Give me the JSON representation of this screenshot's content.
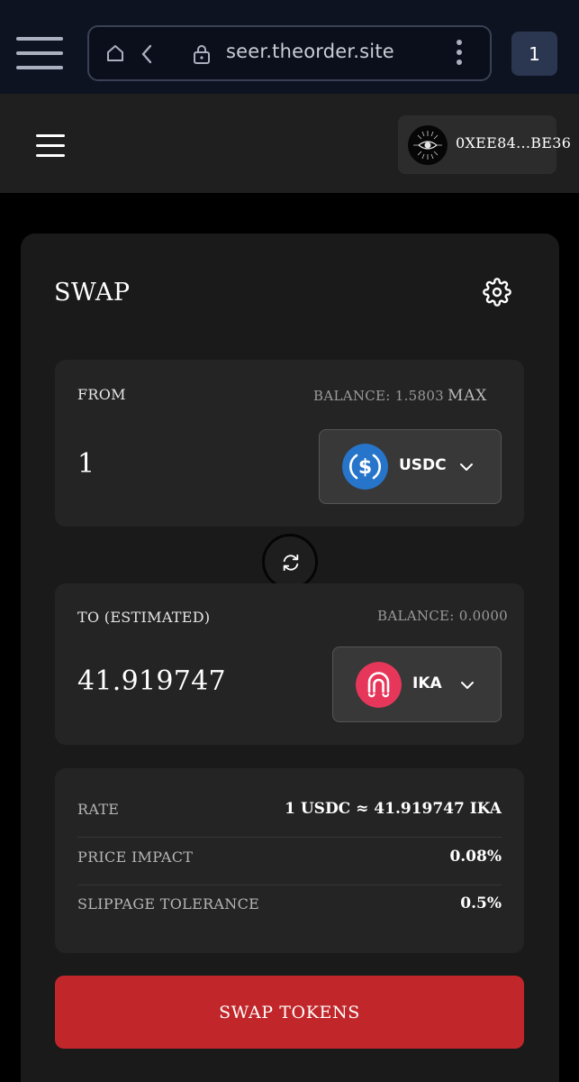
{
  "browser": {
    "url": "seer.theorder.site",
    "tab_count": "1"
  },
  "header": {
    "wallet_address": "0XEE84...BE36"
  },
  "swap": {
    "title": "SWAP",
    "from": {
      "label": "FROM",
      "balance": "BALANCE: 1.5803",
      "max_label": "MAX",
      "amount": "1",
      "token": "USDC",
      "token_icon": "usdc-icon",
      "token_color": "#2775ca"
    },
    "to": {
      "label": "TO (ESTIMATED)",
      "balance": "BALANCE: 0.0000",
      "amount": "41.919747",
      "token": "IKA",
      "token_icon": "ika-icon",
      "token_color": "#e6375a"
    },
    "details": [
      {
        "label": "RATE",
        "value": "1 USDC ≈ 41.919747 IKA"
      },
      {
        "label": "PRICE IMPACT",
        "value": "0.08%"
      },
      {
        "label": "SLIPPAGE TOLERANCE",
        "value": "0.5%"
      }
    ],
    "submit_label": "SWAP TOKENS",
    "accent_color": "#c1272a"
  }
}
